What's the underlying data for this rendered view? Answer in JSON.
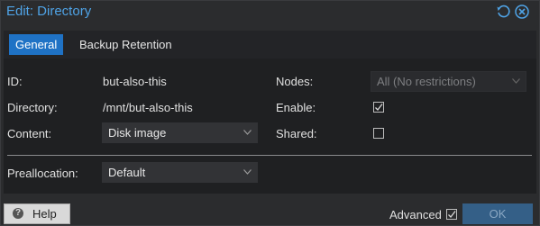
{
  "window": {
    "title": "Edit: Directory"
  },
  "header_icons": [
    "reset-icon",
    "close-icon"
  ],
  "tabs": [
    {
      "label": "General",
      "active": true
    },
    {
      "label": "Backup Retention",
      "active": false
    }
  ],
  "form": {
    "id_label": "ID:",
    "id_value": "but-also-this",
    "directory_label": "Directory:",
    "directory_value": "/mnt/but-also-this",
    "content_label": "Content:",
    "content_value": "Disk image",
    "nodes_label": "Nodes:",
    "nodes_value": "All (No restrictions)",
    "enable_label": "Enable:",
    "enable_checked": true,
    "shared_label": "Shared:",
    "shared_checked": false,
    "preallocation_label": "Preallocation:",
    "preallocation_value": "Default"
  },
  "footer": {
    "help_label": "Help",
    "advanced_label": "Advanced",
    "advanced_checked": true,
    "ok_label": "OK"
  },
  "colors": {
    "accent": "#1f72c5",
    "title": "#4fa3e6",
    "panel_bg": "#1f2022",
    "dialog_bg": "#2b2c2e"
  }
}
